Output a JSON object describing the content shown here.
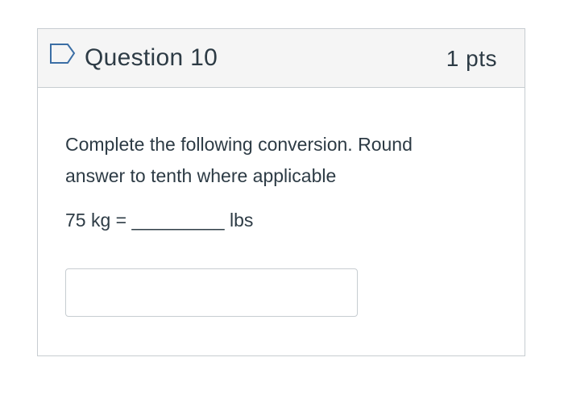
{
  "question": {
    "title": "Question 10",
    "points": "1 pts",
    "flag_icon": "bookmark-flag-icon",
    "prompt_line_1": "Complete the following conversion. Round",
    "prompt_line_2": "answer to tenth where applicable",
    "equation": "75 kg = _________ lbs",
    "answer_value": "",
    "answer_placeholder": ""
  },
  "colors": {
    "header_bg": "#f5f5f5",
    "border": "#c7cdd1",
    "text": "#2d3b45",
    "flag_outline": "#3b6ea5"
  }
}
